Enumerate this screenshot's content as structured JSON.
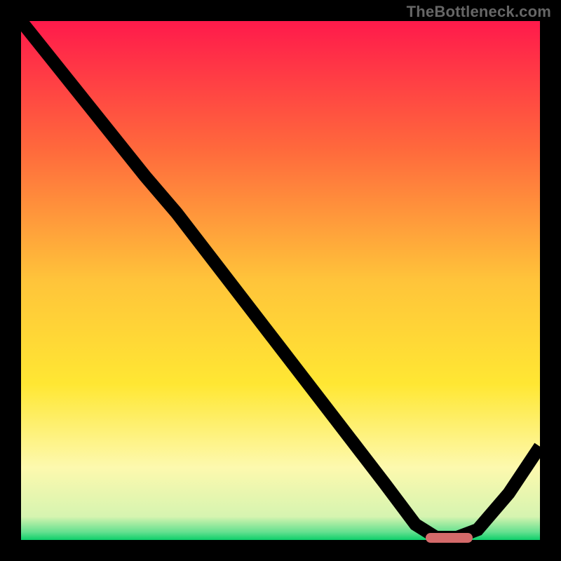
{
  "attribution": "TheBottleneck.com",
  "chart_data": {
    "type": "line",
    "title": "",
    "xlabel": "",
    "ylabel": "",
    "x": [
      0.0,
      0.08,
      0.16,
      0.24,
      0.3,
      0.4,
      0.5,
      0.6,
      0.7,
      0.76,
      0.8,
      0.84,
      0.88,
      0.94,
      1.0
    ],
    "values": [
      1.0,
      0.9,
      0.8,
      0.7,
      0.63,
      0.5,
      0.37,
      0.24,
      0.11,
      0.03,
      0.005,
      0.005,
      0.02,
      0.09,
      0.18
    ],
    "xlim": [
      0,
      1
    ],
    "ylim": [
      0,
      1
    ],
    "optimal_range": {
      "start": 0.78,
      "end": 0.87,
      "y": 0.0
    },
    "gradient_stops": [
      {
        "pos": 0.0,
        "color": "#ff1a4b"
      },
      {
        "pos": 0.25,
        "color": "#ff6a3c"
      },
      {
        "pos": 0.5,
        "color": "#ffc43a"
      },
      {
        "pos": 0.7,
        "color": "#ffe733"
      },
      {
        "pos": 0.86,
        "color": "#fdf9ae"
      },
      {
        "pos": 0.955,
        "color": "#d6f4b0"
      },
      {
        "pos": 0.985,
        "color": "#63e08f"
      },
      {
        "pos": 1.0,
        "color": "#0ccf6a"
      }
    ]
  }
}
